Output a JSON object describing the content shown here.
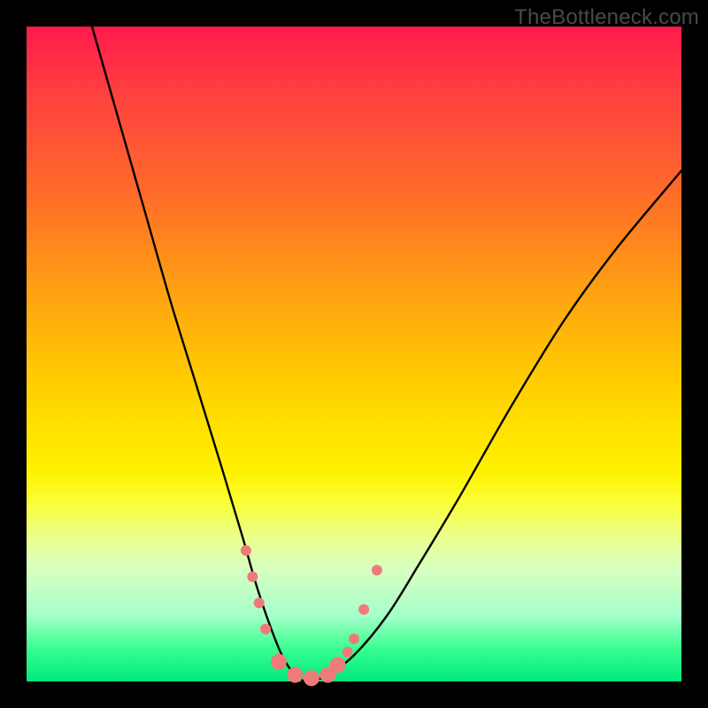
{
  "watermark": "TheBottleneck.com",
  "chart_data": {
    "type": "line",
    "title": "",
    "xlabel": "",
    "ylabel": "",
    "xlim": [
      0,
      100
    ],
    "ylim": [
      0,
      100
    ],
    "grid": false,
    "series": [
      {
        "name": "bottleneck-curve",
        "x": [
          10,
          14,
          18,
          22,
          26,
          30,
          33,
          35,
          37,
          39,
          41,
          43,
          46,
          50,
          55,
          60,
          66,
          74,
          82,
          90,
          100
        ],
        "y": [
          100,
          86,
          72,
          58,
          45,
          32,
          22,
          15,
          9,
          4,
          1,
          0,
          1,
          4,
          10,
          18,
          28,
          42,
          55,
          66,
          78
        ]
      }
    ],
    "markers": {
      "name": "highlight-dots",
      "color": "#ef7a7a",
      "radius_small": 6,
      "radius_large": 9,
      "points": [
        {
          "x": 33.5,
          "y": 20,
          "r": "small"
        },
        {
          "x": 34.5,
          "y": 16,
          "r": "small"
        },
        {
          "x": 35.5,
          "y": 12,
          "r": "small"
        },
        {
          "x": 36.5,
          "y": 8,
          "r": "small"
        },
        {
          "x": 38.5,
          "y": 3,
          "r": "large"
        },
        {
          "x": 41.0,
          "y": 1,
          "r": "large"
        },
        {
          "x": 43.5,
          "y": 0.5,
          "r": "large"
        },
        {
          "x": 46.0,
          "y": 1,
          "r": "large"
        },
        {
          "x": 47.5,
          "y": 2.5,
          "r": "large"
        },
        {
          "x": 49.0,
          "y": 4.5,
          "r": "small"
        },
        {
          "x": 50.0,
          "y": 6.5,
          "r": "small"
        },
        {
          "x": 51.5,
          "y": 11,
          "r": "small"
        },
        {
          "x": 53.5,
          "y": 17,
          "r": "small"
        }
      ]
    }
  }
}
